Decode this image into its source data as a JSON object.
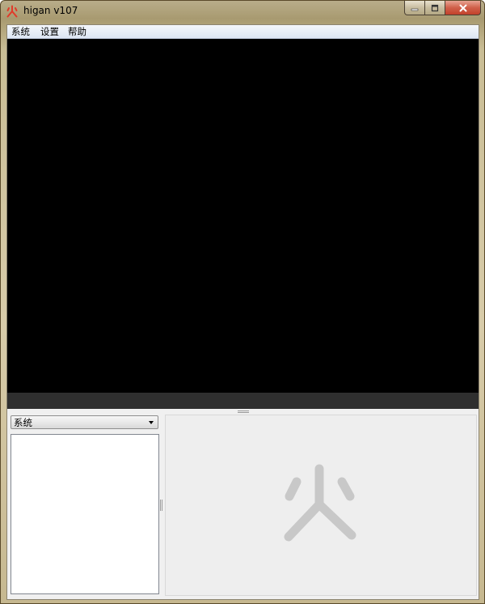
{
  "window": {
    "title": "higan v107"
  },
  "menubar": {
    "items": [
      "系统",
      "设置",
      "帮助"
    ]
  },
  "system_panel": {
    "selected": "系统"
  },
  "colors": {
    "accent_red": "#e03a2a",
    "watermark": "#c8c8c8"
  },
  "icons": {
    "app": "higan-fire-icon",
    "watermark": "higan-fire-logo"
  }
}
